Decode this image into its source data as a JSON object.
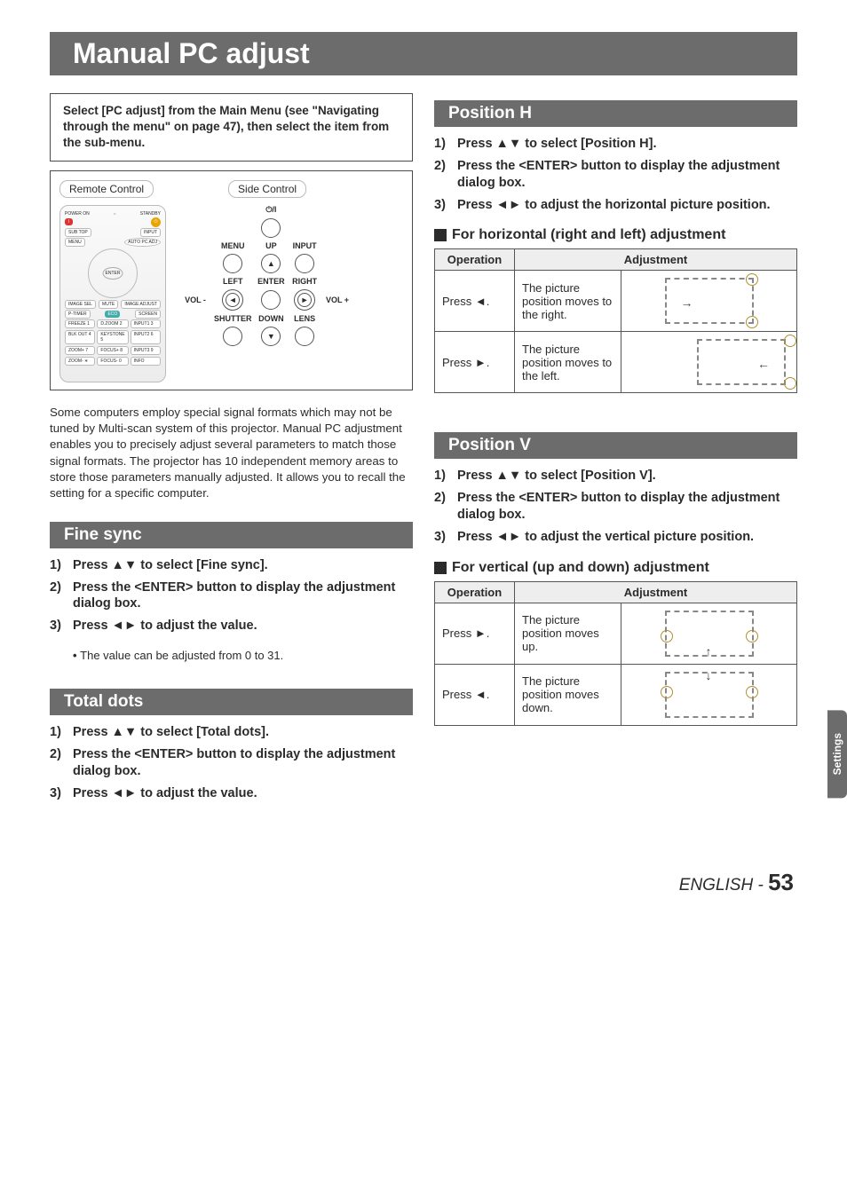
{
  "title": "Manual PC adjust",
  "intro_box": "Select [PC adjust] from the Main Menu (see \"Navigating through the menu\" on page 47), then select the item from the sub-menu.",
  "controls": {
    "remote_label": "Remote Control",
    "side_label": "Side Control",
    "remote_buttons": {
      "power_on": "POWER ON",
      "standby": "STANDBY",
      "on": "I",
      "sb": "⏻",
      "sub_top": "SUB TOP",
      "input": "INPUT",
      "menu": "MENU",
      "auto_pc": "AUTO PC ADJ",
      "vol_minus": "VOL-",
      "vol_plus": "VOL+",
      "enter": "ENTER",
      "image_sel": "IMAGE SEL",
      "mute": "MUTE",
      "image_adj": "IMAGE ADJUST",
      "ptimer": "P-TIMER",
      "eco": "ECO",
      "screen": "SCREEN",
      "freeze": "FREEZE 1",
      "dzoom": "D.ZOOM 2",
      "input1": "INPUT1 3",
      "blkout": "BLK OUT 4",
      "keystone": "KEYSTONE 5",
      "input2": "INPUT2 6",
      "zoomp": "ZOOM+ 7",
      "focusp": "FOCUS+ 8",
      "input3": "INPUT3 9",
      "zoomm": "ZOOM- ∗",
      "focusm": "FOCUS- 0",
      "info": "INFO"
    },
    "side": {
      "power_icon": "⏻/I",
      "menu": "MENU",
      "up": "UP",
      "input": "INPUT",
      "left": "LEFT",
      "enter": "ENTER",
      "right": "RIGHT",
      "vol_m": "VOL -",
      "vol_p": "VOL +",
      "shutter": "SHUTTER",
      "down": "DOWN",
      "lens": "LENS"
    }
  },
  "body_para": "Some computers employ special signal formats which may not be tuned by Multi-scan system of this projector. Manual PC adjustment enables you to precisely adjust several parameters to match those signal formats. The projector has 10 independent memory areas to store those parameters manually adjusted. It allows you to recall the setting for a specific computer.",
  "sections": {
    "fine_sync": {
      "heading": "Fine sync",
      "steps": [
        "Press ▲▼ to select [Fine sync].",
        "Press the <ENTER> button to display the adjustment dialog box.",
        "Press ◄► to adjust the value."
      ],
      "note": "The value can be adjusted from 0 to 31."
    },
    "total_dots": {
      "heading": "Total dots",
      "steps": [
        "Press ▲▼ to select [Total dots].",
        "Press the <ENTER> button to display the adjustment dialog box.",
        "Press ◄► to adjust the value."
      ]
    },
    "position_h": {
      "heading": "Position H",
      "steps": [
        "Press ▲▼ to select [Position H].",
        "Press the <ENTER> button to display the adjustment dialog box.",
        "Press ◄► to adjust the horizontal picture position."
      ],
      "sub_heading": "For horizontal (right and left) adjustment",
      "table_headers": [
        "Operation",
        "Adjustment"
      ],
      "rows": [
        {
          "op": "Press ◄.",
          "desc": "The picture position moves to the right."
        },
        {
          "op": "Press ►.",
          "desc": "The picture position moves to the left."
        }
      ]
    },
    "position_v": {
      "heading": "Position V",
      "steps": [
        "Press ▲▼ to select [Position V].",
        "Press the <ENTER> button to display the adjustment dialog box.",
        "Press ◄► to adjust the vertical picture position."
      ],
      "sub_heading": "For vertical (up and down) adjustment",
      "table_headers": [
        "Operation",
        "Adjustment"
      ],
      "rows": [
        {
          "op": "Press ►.",
          "desc": "The picture position moves up."
        },
        {
          "op": "Press ◄.",
          "desc": "The picture position moves down."
        }
      ]
    }
  },
  "side_tab": "Settings",
  "footer_lang": "ENGLISH - ",
  "footer_page": "53"
}
